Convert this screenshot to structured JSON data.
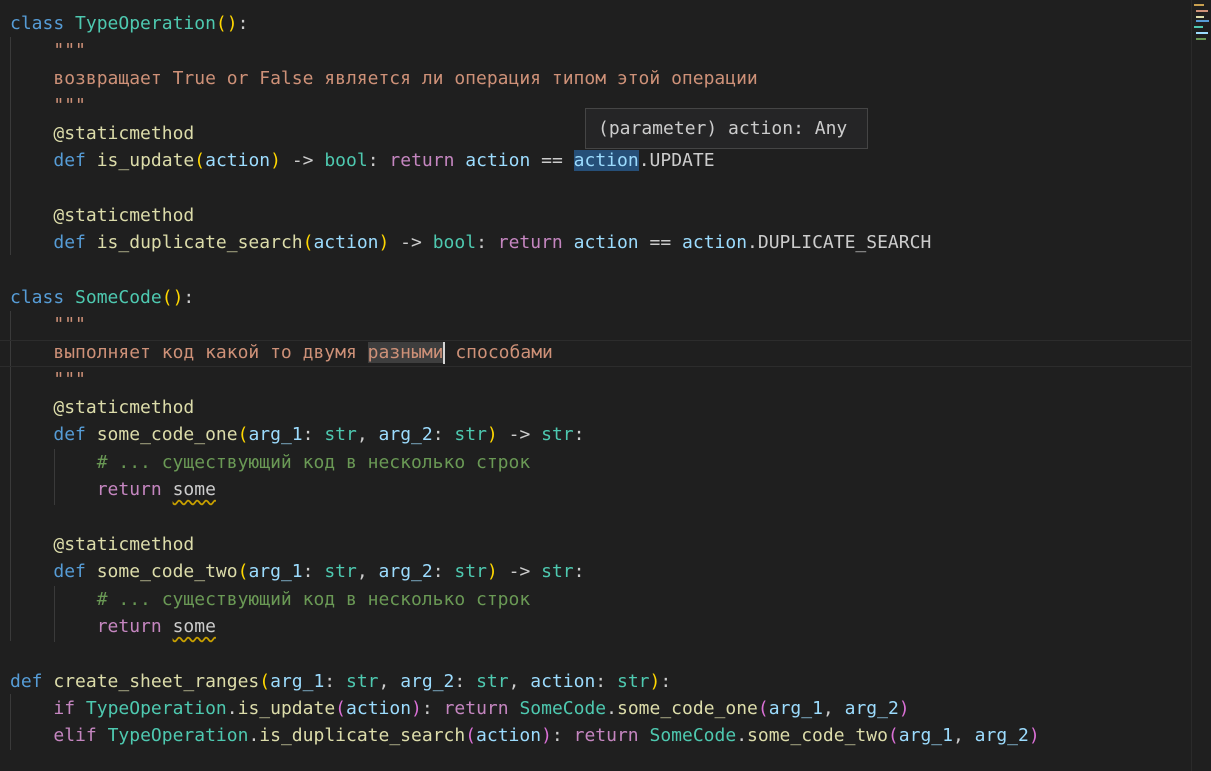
{
  "hover": {
    "text": "(parameter) action: Any"
  },
  "code": {
    "l1": {
      "kw": "class",
      "name": "TypeOperation",
      "br": "()",
      "colon": ":"
    },
    "l2": {
      "doc": "\"\"\""
    },
    "l3": {
      "doc": "возвращает True or False является ли операция типом этой операции"
    },
    "l4": {
      "doc": "\"\"\""
    },
    "l5": {
      "deco": "@staticmethod"
    },
    "l6": {
      "def": "def",
      "fn": "is_update",
      "op": "(",
      "p": "action",
      "cp": ")",
      "arrow": " -> ",
      "type": "bool",
      "colon": ": ",
      "ret": "return",
      "sp": " ",
      "a1": "action",
      "eq": " == ",
      "a2": "action",
      "attr": ".UPDATE"
    },
    "l8": {
      "deco": "@staticmethod"
    },
    "l9": {
      "def": "def",
      "fn": "is_duplicate_search",
      "op": "(",
      "p": "action",
      "cp": ")",
      "arrow": " -> ",
      "type": "bool",
      "colon": ": ",
      "ret": "return",
      "sp": " ",
      "a1": "action",
      "eq": " == ",
      "a2": "action",
      "attr": ".DUPLICATE_SEARCH"
    },
    "l11": {
      "kw": "class",
      "name": "SomeCode",
      "br": "()",
      "colon": ":"
    },
    "l12": {
      "doc": "\"\"\""
    },
    "l13": {
      "pre": "выполняет код какой то двумя ",
      "sel": "разными",
      "post": " способами"
    },
    "l14": {
      "doc": "\"\"\""
    },
    "l15": {
      "deco": "@staticmethod"
    },
    "l16": {
      "def": "def",
      "fn": "some_code_one",
      "op": "(",
      "p1": "arg_1",
      "c1": ": ",
      "t1": "str",
      "cm": ", ",
      "p2": "arg_2",
      "c2": ": ",
      "t2": "str",
      "cp": ")",
      "arrow": " -> ",
      "rt": "str",
      "colon": ":"
    },
    "l17": {
      "cmt": "# ... существующий код в несколько строк"
    },
    "l18": {
      "ret": "return",
      "sp": " ",
      "val": "some"
    },
    "l20": {
      "deco": "@staticmethod"
    },
    "l21": {
      "def": "def",
      "fn": "some_code_two",
      "op": "(",
      "p1": "arg_1",
      "c1": ": ",
      "t1": "str",
      "cm": ", ",
      "p2": "arg_2",
      "c2": ": ",
      "t2": "str",
      "cp": ")",
      "arrow": " -> ",
      "rt": "str",
      "colon": ":"
    },
    "l22": {
      "cmt": "# ... существующий код в несколько строк"
    },
    "l23": {
      "ret": "return",
      "sp": " ",
      "val": "some"
    },
    "l25": {
      "def": "def",
      "fn": "create_sheet_ranges",
      "op": "(",
      "p1": "arg_1",
      "c1": ": ",
      "t1": "str",
      "cm1": ", ",
      "p2": "arg_2",
      "c2": ": ",
      "t2": "str",
      "cm2": ", ",
      "p3": "action",
      "c3": ": ",
      "t3": "str",
      "cp": ")",
      "colon": ":"
    },
    "l26": {
      "kw": "if",
      "sp": " ",
      "cls": "TypeOperation",
      "dot": ".",
      "fn": "is_update",
      "op": "(",
      "a": "action",
      "cp": ")",
      "colon": ": ",
      "ret": "return",
      "sp2": " ",
      "cls2": "SomeCode",
      "dot2": ".",
      "fn2": "some_code_one",
      "op2": "(",
      "a1": "arg_1",
      "cm": ", ",
      "a2": "arg_2",
      "cp2": ")"
    },
    "l27": {
      "kw": "elif",
      "sp": " ",
      "cls": "TypeOperation",
      "dot": ".",
      "fn": "is_duplicate_search",
      "op": "(",
      "a": "action",
      "cp": ")",
      "colon": ": ",
      "ret": "return",
      "sp2": " ",
      "cls2": "SomeCode",
      "dot2": ".",
      "fn2": "some_code_two",
      "op2": "(",
      "a1": "arg_1",
      "cm": ", ",
      "a2": "arg_2",
      "cp2": ")"
    }
  },
  "colors": {
    "background": "#1f1f1f",
    "keyword": "#569cd6",
    "control_keyword": "#c586c0",
    "class_name": "#4ec9b0",
    "function_name": "#dcdcaa",
    "parameter": "#9cdcfe",
    "string": "#ce9178",
    "comment": "#6a9955"
  }
}
